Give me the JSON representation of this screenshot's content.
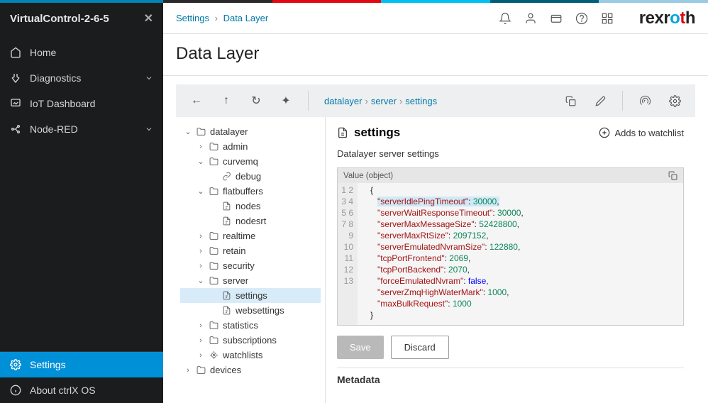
{
  "sidebar": {
    "title": "VirtualControl-2-6-5",
    "items": [
      {
        "icon": "home",
        "label": "Home",
        "expandable": false
      },
      {
        "icon": "diag",
        "label": "Diagnostics",
        "expandable": true
      },
      {
        "icon": "dash",
        "label": "IoT Dashboard",
        "expandable": false
      },
      {
        "icon": "nodered",
        "label": "Node-RED",
        "expandable": true
      }
    ],
    "footer": {
      "settings": "Settings",
      "about": "About ctrlX OS"
    }
  },
  "breadcrumb": [
    "Settings",
    "Data Layer"
  ],
  "page_title": "Data Layer",
  "brand": "rexroth",
  "toolbar_path": [
    "datalayer",
    "server",
    "settings"
  ],
  "tree": {
    "root": "datalayer",
    "children": [
      {
        "type": "folder",
        "label": "admin",
        "open": false
      },
      {
        "type": "folder",
        "label": "curvemq",
        "open": true,
        "children": [
          {
            "type": "link",
            "label": "debug"
          }
        ]
      },
      {
        "type": "folder",
        "label": "flatbuffers",
        "open": true,
        "children": [
          {
            "type": "file",
            "label": "nodes"
          },
          {
            "type": "file",
            "label": "nodesrt"
          }
        ]
      },
      {
        "type": "folder",
        "label": "realtime",
        "open": false
      },
      {
        "type": "folder",
        "label": "retain",
        "open": false
      },
      {
        "type": "folder",
        "label": "security",
        "open": false
      },
      {
        "type": "folder",
        "label": "server",
        "open": true,
        "children": [
          {
            "type": "file",
            "label": "settings",
            "selected": true
          },
          {
            "type": "file",
            "label": "websettings"
          }
        ]
      },
      {
        "type": "folder",
        "label": "statistics",
        "open": false
      },
      {
        "type": "folder",
        "label": "subscriptions",
        "open": false
      },
      {
        "type": "watch",
        "label": "watchlists",
        "open": false
      },
      {
        "type": "folder",
        "label": "devices",
        "open": false,
        "level": 0
      }
    ]
  },
  "details": {
    "title": "settings",
    "watchlist_label": "Adds to watchlist",
    "description": "Datalayer server settings",
    "value_label": "Value (object)",
    "json_lines": [
      {
        "n": 1,
        "text": "{"
      },
      {
        "n": 2,
        "key": "serverIdlePingTimeout",
        "val": "30000",
        "t": "num",
        "hl": true,
        "comma": true
      },
      {
        "n": 3,
        "key": "serverWaitResponseTimeout",
        "val": "30000",
        "t": "num",
        "comma": true
      },
      {
        "n": 4,
        "key": "serverMaxMessageSize",
        "val": "52428800",
        "t": "num",
        "comma": true
      },
      {
        "n": 5,
        "key": "serverMaxRtSize",
        "val": "2097152",
        "t": "num",
        "comma": true
      },
      {
        "n": 6,
        "key": "serverEmulatedNvramSize",
        "val": "122880",
        "t": "num",
        "comma": true
      },
      {
        "n": 7,
        "key": "tcpPortFrontend",
        "val": "2069",
        "t": "num",
        "comma": true
      },
      {
        "n": 8,
        "key": "tcpPortBackend",
        "val": "2070",
        "t": "num",
        "comma": true
      },
      {
        "n": 9,
        "key": "forceEmulatedNvram",
        "val": "false",
        "t": "bool",
        "comma": true
      },
      {
        "n": 10,
        "key": "serverZmqHighWaterMark",
        "val": "1000",
        "t": "num",
        "comma": true
      },
      {
        "n": 11,
        "key": "maxBulkRequest",
        "val": "1000",
        "t": "num",
        "comma": false
      },
      {
        "n": 12,
        "text": "}"
      },
      {
        "n": 13,
        "text": ""
      }
    ],
    "actions": {
      "save": "Save",
      "discard": "Discard"
    },
    "metadata_label": "Metadata"
  }
}
